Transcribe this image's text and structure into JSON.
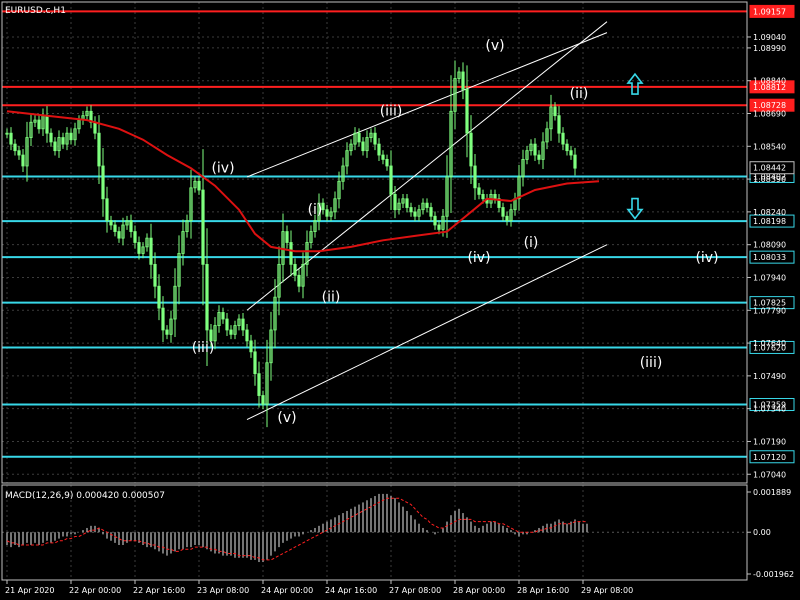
{
  "window": {
    "symbol_title": "EURUSD.c,H1"
  },
  "colors": {
    "background": "#000000",
    "candle": "#7fff7f",
    "grid": "#3c3c3c",
    "frame": "#c0c0c0",
    "ma": "#dd1111",
    "resistance": "#ff1f1f",
    "support": "#38d8e8",
    "channel": "#ffffff",
    "arrow": "#38d8e8",
    "macd_hist": "#c0c0c0",
    "macd_signal": "#ff2020"
  },
  "chart_data": [
    {
      "type": "candlestick",
      "title": "EURUSD.c,H1",
      "ylim": [
        1.07,
        1.092
      ],
      "y_ticks": [
        "1.09040",
        "1.08990",
        "1.08840",
        "1.08690",
        "1.08540",
        "1.08390",
        "1.08240",
        "1.08090",
        "1.07940",
        "1.07790",
        "1.07640",
        "1.07490",
        "1.07340",
        "1.07190",
        "1.07040"
      ],
      "y_tick_values": [
        1.0904,
        1.0899,
        1.0884,
        1.0869,
        1.0854,
        1.0839,
        1.0824,
        1.0809,
        1.0794,
        1.0779,
        1.0764,
        1.0749,
        1.0734,
        1.0719,
        1.0704
      ],
      "x_ticks": [
        "21 Apr 2020",
        "22 Apr 00:00",
        "22 Apr 16:00",
        "23 Apr 08:00",
        "24 Apr 00:00",
        "24 Apr 16:00",
        "27 Apr 08:00",
        "28 Apr 00:00",
        "28 Apr 16:00",
        "29 Apr 08:00"
      ],
      "x_tick_bars": [
        0,
        16,
        32,
        48,
        64,
        80,
        96,
        112,
        128,
        144
      ],
      "closes": [
        1.086,
        1.0855,
        1.0852,
        1.085,
        1.0845,
        1.0858,
        1.0865,
        1.0866,
        1.0862,
        1.0868,
        1.086,
        1.0856,
        1.0852,
        1.0858,
        1.0855,
        1.086,
        1.0857,
        1.0862,
        1.0866,
        1.0868,
        1.087,
        1.0865,
        1.086,
        1.0845,
        1.083,
        1.082,
        1.0818,
        1.0815,
        1.0812,
        1.0818,
        1.082,
        1.0815,
        1.081,
        1.0805,
        1.0808,
        1.0812,
        1.08,
        1.079,
        1.078,
        1.077,
        1.0768,
        1.0775,
        1.079,
        1.0805,
        1.0815,
        1.082,
        1.0835,
        1.0838,
        1.0834,
        1.08,
        1.077,
        1.0765,
        1.0772,
        1.0778,
        1.0775,
        1.077,
        1.0768,
        1.0772,
        1.0775,
        1.077,
        1.0765,
        1.076,
        1.075,
        1.074,
        1.0736,
        1.0755,
        1.077,
        1.0785,
        1.08,
        1.0815,
        1.081,
        1.08,
        1.0795,
        1.079,
        1.08,
        1.081,
        1.0815,
        1.082,
        1.0828,
        1.0825,
        1.0822,
        1.0824,
        1.083,
        1.0838,
        1.0845,
        1.0852,
        1.0855,
        1.086,
        1.0856,
        1.0852,
        1.0858,
        1.086,
        1.0855,
        1.085,
        1.0848,
        1.0845,
        1.0832,
        1.0825,
        1.0828,
        1.083,
        1.0826,
        1.0824,
        1.0822,
        1.0825,
        1.0828,
        1.0826,
        1.0822,
        1.0818,
        1.0816,
        1.0822,
        1.084,
        1.087,
        1.0885,
        1.0888,
        1.088,
        1.086,
        1.0845,
        1.0835,
        1.0832,
        1.083,
        1.0828,
        1.0832,
        1.083,
        1.0826,
        1.0822,
        1.082,
        1.0825,
        1.083,
        1.084,
        1.0848,
        1.0852,
        1.0855,
        1.085,
        1.0848,
        1.0856,
        1.0862,
        1.0872,
        1.0868,
        1.086,
        1.0855,
        1.0852,
        1.085,
        1.0844
      ],
      "ma_points": [
        [
          0,
          1.087
        ],
        [
          10,
          1.0868
        ],
        [
          20,
          1.0866
        ],
        [
          28,
          1.0862
        ],
        [
          34,
          1.0857
        ],
        [
          40,
          1.085
        ],
        [
          46,
          1.0844
        ],
        [
          52,
          1.0836
        ],
        [
          58,
          1.0825
        ],
        [
          62,
          1.0814
        ],
        [
          66,
          1.0808
        ],
        [
          72,
          1.0806
        ],
        [
          78,
          1.0806
        ],
        [
          86,
          1.0808
        ],
        [
          94,
          1.0811
        ],
        [
          102,
          1.0813
        ],
        [
          110,
          1.0815
        ],
        [
          114,
          1.0821
        ],
        [
          120,
          1.083
        ],
        [
          126,
          1.0829
        ],
        [
          132,
          1.0834
        ],
        [
          140,
          1.0837
        ],
        [
          148,
          1.0838
        ]
      ],
      "resistance_levels": [
        {
          "value": 1.09157,
          "label": "1.09157"
        },
        {
          "value": 1.08812,
          "label": "1.08812"
        },
        {
          "value": 1.08728,
          "label": "1.08728"
        }
      ],
      "support_levels": [
        {
          "value": 1.08402,
          "label": "1.08402"
        },
        {
          "value": 1.08198,
          "label": "1.08198"
        },
        {
          "value": 1.08033,
          "label": "1.08033"
        },
        {
          "value": 1.07825,
          "label": "1.07825"
        },
        {
          "value": 1.0762,
          "label": "1.07620"
        },
        {
          "value": 1.07359,
          "label": "1.07359"
        },
        {
          "value": 1.0712,
          "label": "1.07120"
        }
      ],
      "current_price": {
        "value": 1.08442,
        "label": "1.08442"
      },
      "channel_lines": [
        {
          "from": [
            60,
            1.0779
          ],
          "to": [
            150,
            1.0911
          ]
        },
        {
          "from": [
            60,
            1.084
          ],
          "to": [
            150,
            1.0906
          ]
        },
        {
          "from": [
            60,
            1.0729
          ],
          "to": [
            150,
            1.0809
          ]
        }
      ],
      "wave_labels": [
        {
          "text": "(iv)",
          "bar": 54,
          "price": 1.0842
        },
        {
          "text": "(iii)",
          "bar": 49,
          "price": 1.076
        },
        {
          "text": "(v)",
          "bar": 70,
          "price": 1.0728
        },
        {
          "text": "(i)",
          "bar": 77,
          "price": 1.0823
        },
        {
          "text": "(ii)",
          "bar": 81,
          "price": 1.0783
        },
        {
          "text": "(iii)",
          "bar": 96,
          "price": 1.0868
        },
        {
          "text": "(v)",
          "bar": 122,
          "price": 1.0898
        },
        {
          "text": "(iv)",
          "bar": 118,
          "price": 1.0801
        },
        {
          "text": "(i)",
          "bar": 131,
          "price": 1.0808
        },
        {
          "text": "(ii)",
          "bar": 143,
          "price": 1.0876
        },
        {
          "text": "(iv)",
          "bar": 175,
          "price": 1.0801
        },
        {
          "text": "(iii)",
          "bar": 161,
          "price": 1.0753
        }
      ],
      "arrows": [
        {
          "direction": "up",
          "bar": 157,
          "price": 1.0882
        },
        {
          "direction": "down",
          "bar": 157,
          "price": 1.0826
        }
      ]
    },
    {
      "type": "bar",
      "title": "MACD(12,26,9) 0.000420 0.000507",
      "y_ticks": [
        "0.001889",
        "0.00",
        "-0.001962"
      ],
      "y_tick_values": [
        0.001889,
        0.0,
        -0.001962
      ],
      "ylim": [
        -0.001962,
        0.001889
      ],
      "histogram": [
        -0.0006,
        -0.0007,
        -0.0006,
        -0.0007,
        -0.0006,
        -0.0005,
        -0.0006,
        -0.0005,
        -0.0006,
        -0.0005,
        -0.0004,
        -0.0005,
        -0.0004,
        -0.0003,
        -0.0002,
        -0.0002,
        -0.0001,
        -0.0001,
        0.0,
        0.0001,
        0.0002,
        0.0003,
        0.0003,
        0.0002,
        -0.0001,
        -0.0003,
        -0.0004,
        -0.0005,
        -0.0006,
        -0.0006,
        -0.0005,
        -0.0004,
        -0.0004,
        -0.0005,
        -0.0006,
        -0.0007,
        -0.0007,
        -0.0008,
        -0.0009,
        -0.001,
        -0.0011,
        -0.001,
        -0.0009,
        -0.0008,
        -0.0008,
        -0.0007,
        -0.0007,
        -0.0006,
        -0.0006,
        -0.0007,
        -0.0008,
        -0.0009,
        -0.001,
        -0.001,
        -0.0011,
        -0.0011,
        -0.0011,
        -0.0012,
        -0.0012,
        -0.0012,
        -0.0012,
        -0.0013,
        -0.0013,
        -0.0014,
        -0.0014,
        -0.0013,
        -0.0011,
        -0.0009,
        -0.0007,
        -0.0005,
        -0.0004,
        -0.0003,
        -0.0002,
        -0.0002,
        -0.0001,
        0.0,
        0.0001,
        0.0002,
        0.0003,
        0.0004,
        0.0005,
        0.0006,
        0.0007,
        0.0008,
        0.0009,
        0.001,
        0.0011,
        0.0012,
        0.0013,
        0.0014,
        0.0015,
        0.0016,
        0.0017,
        0.0018,
        0.0018,
        0.0018,
        0.0017,
        0.0016,
        0.0014,
        0.0012,
        0.001,
        0.0008,
        0.0006,
        0.0004,
        0.0002,
        0.0001,
        0.0,
        -0.0001,
        0.0,
        0.0002,
        0.0005,
        0.0008,
        0.001,
        0.0011,
        0.0009,
        0.0007,
        0.0005,
        0.0003,
        0.0002,
        0.0003,
        0.0004,
        0.0005,
        0.0005,
        0.0004,
        0.0003,
        0.0002,
        0.0001,
        -0.0001,
        -0.0002,
        -0.0001,
        -0.0001,
        0.0,
        0.0001,
        0.0002,
        0.0003,
        0.0004,
        0.0004,
        0.0005,
        0.0006,
        0.0005,
        0.0004,
        0.0005,
        0.0006,
        0.0005,
        0.0004,
        0.0004
      ],
      "signal": [
        -0.0004,
        -0.0005,
        -0.0005,
        -0.0006,
        -0.0006,
        -0.0006,
        -0.0006,
        -0.0006,
        -0.0006,
        -0.0006,
        -0.0005,
        -0.0005,
        -0.0005,
        -0.0004,
        -0.0004,
        -0.0003,
        -0.0003,
        -0.0002,
        -0.0002,
        -0.0001,
        0.0,
        0.0001,
        0.0001,
        0.0002,
        0.0001,
        0.0,
        -0.0001,
        -0.0002,
        -0.0003,
        -0.0004,
        -0.0004,
        -0.0004,
        -0.0004,
        -0.0004,
        -0.0005,
        -0.0005,
        -0.0006,
        -0.0006,
        -0.0007,
        -0.0007,
        -0.0008,
        -0.0008,
        -0.0009,
        -0.0009,
        -0.0008,
        -0.0008,
        -0.0008,
        -0.0007,
        -0.0007,
        -0.0007,
        -0.0007,
        -0.0008,
        -0.0008,
        -0.0009,
        -0.0009,
        -0.001,
        -0.001,
        -0.001,
        -0.0011,
        -0.0011,
        -0.0011,
        -0.0011,
        -0.0012,
        -0.0012,
        -0.0013,
        -0.0013,
        -0.0013,
        -0.0012,
        -0.0011,
        -0.001,
        -0.0009,
        -0.0008,
        -0.0007,
        -0.0006,
        -0.0005,
        -0.0004,
        -0.0003,
        -0.0002,
        -0.0001,
        0.0,
        0.0001,
        0.0002,
        0.0003,
        0.0004,
        0.0005,
        0.0006,
        0.0007,
        0.0008,
        0.0009,
        0.001,
        0.0011,
        0.0012,
        0.0013,
        0.0014,
        0.0015,
        0.0016,
        0.0016,
        0.0016,
        0.0016,
        0.0015,
        0.0014,
        0.0013,
        0.0011,
        0.0009,
        0.0007,
        0.0006,
        0.0004,
        0.0003,
        0.0002,
        0.0002,
        0.0003,
        0.0004,
        0.0005,
        0.0006,
        0.0006,
        0.0006,
        0.0006,
        0.0005,
        0.0005,
        0.0005,
        0.0005,
        0.0005,
        0.0005,
        0.0004,
        0.0004,
        0.0003,
        0.0002,
        0.0001,
        0.0,
        0.0,
        0.0,
        0.0,
        0.0,
        0.0001,
        0.0001,
        0.0002,
        0.0002,
        0.0003,
        0.0004,
        0.0004,
        0.0004,
        0.0004,
        0.0005,
        0.0005,
        0.0005,
        0.0005
      ]
    }
  ]
}
